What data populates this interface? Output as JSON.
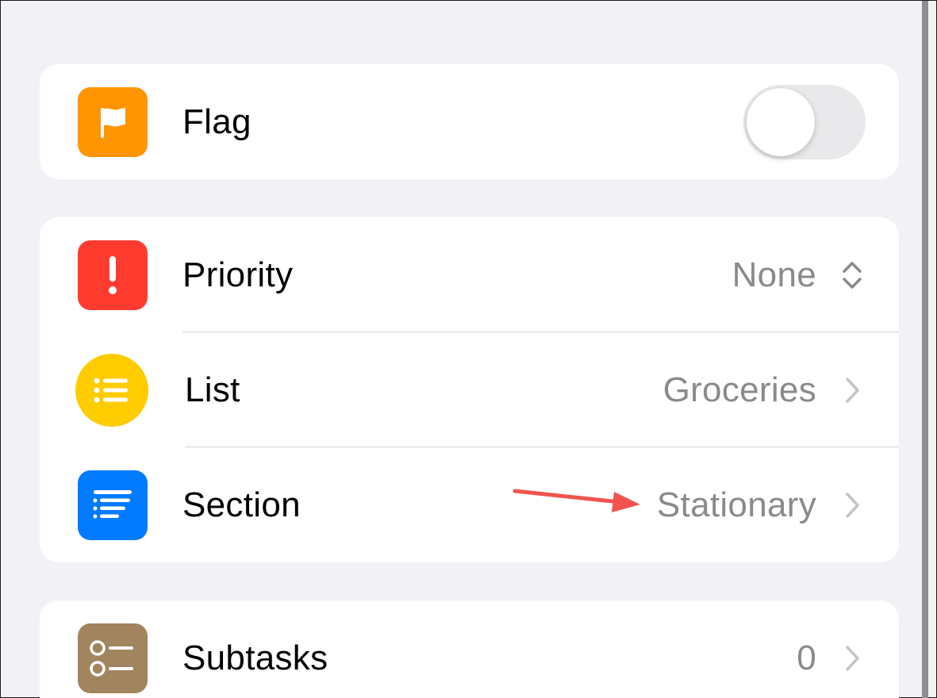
{
  "flag_card": {
    "flag": {
      "label": "Flag",
      "icon": "flag-icon",
      "color": "#ff9500",
      "toggle_on": false
    }
  },
  "details_card": {
    "priority": {
      "label": "Priority",
      "value": "None",
      "icon": "exclamation-icon",
      "color": "#ff3b30",
      "accessory": "up-down-chevron-icon"
    },
    "list": {
      "label": "List",
      "value": "Groceries",
      "icon": "list-bullet-icon",
      "color": "#ffcc00",
      "accessory": "chevron-right-icon"
    },
    "section": {
      "label": "Section",
      "value": "Stationary",
      "icon": "text-alignleft-icon",
      "color": "#007aff",
      "accessory": "chevron-right-icon"
    }
  },
  "subtasks_card": {
    "subtasks": {
      "label": "Subtasks",
      "value": "0",
      "icon": "checklist-icon",
      "color": "#a2845e",
      "accessory": "chevron-right-icon"
    }
  },
  "annotation": {
    "type": "arrow",
    "color": "#f0544f",
    "points_to": "section-value"
  }
}
